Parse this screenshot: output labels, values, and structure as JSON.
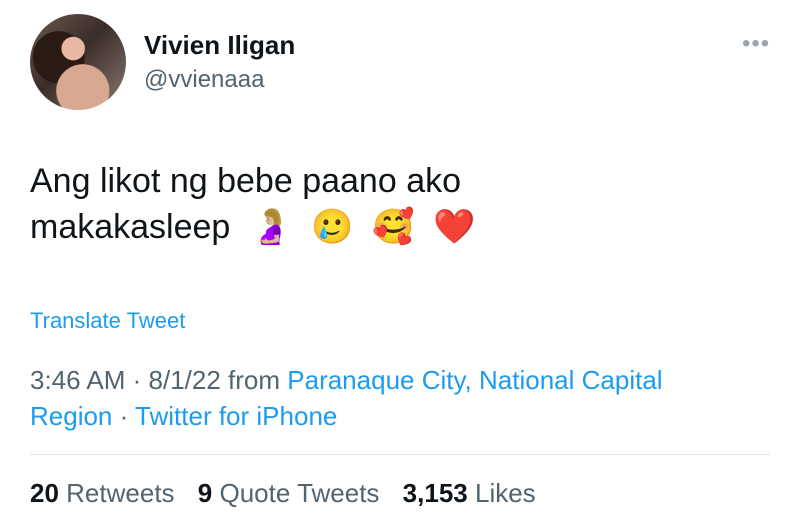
{
  "user": {
    "name": "Vivien Iligan",
    "handle": "@vvienaaa"
  },
  "menu": {
    "more_label": "•••"
  },
  "tweet": {
    "line1": "Ang likot ng bebe paano ako",
    "line2": "makakasleep",
    "emojis": [
      "🤰🏼",
      "🥲",
      "🥰",
      "❤️"
    ]
  },
  "translate_label": "Translate Tweet",
  "meta": {
    "time": "3:46 AM",
    "sep1": " · ",
    "date": "8/1/22",
    "from": " from ",
    "location": "Paranaque City, National Capital Region",
    "sep2": " · ",
    "source": "Twitter for iPhone"
  },
  "stats": {
    "retweets_count": "20",
    "retweets_label": "Retweets",
    "quotes_count": "9",
    "quotes_label": "Quote Tweets",
    "likes_count": "3,153",
    "likes_label": "Likes"
  }
}
